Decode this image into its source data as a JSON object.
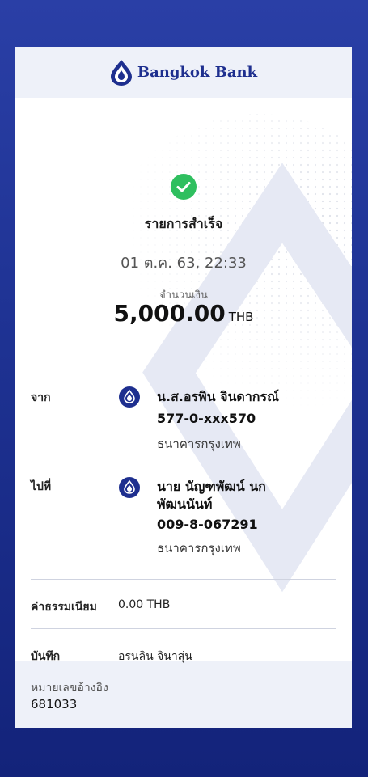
{
  "header": {
    "bank_name": "Bangkok Bank",
    "logo_icon": "lotus-logo-icon"
  },
  "status": {
    "icon": "check-circle-icon",
    "text": "รายการสำเร็จ",
    "color": "#2fbf5f"
  },
  "datetime": "01 ต.ค. 63, 22:33",
  "amount": {
    "label": "จำนวนเงิน",
    "value": "5,000.00",
    "currency": "THB"
  },
  "from": {
    "label": "จาก",
    "icon": "bangkok-bank-icon",
    "name": "น.ส.อรพิน  จินดากรณ์",
    "account": "577-0-xxx570",
    "bank": "ธนาคารกรุงเทพ"
  },
  "to": {
    "label": "ไปที่",
    "icon": "bangkok-bank-icon",
    "name": "นาย นัญฑพัฒน์ นก พัฒนนันท์",
    "account": "009-8-067291",
    "bank": "ธนาคารกรุงเทพ"
  },
  "fee": {
    "label": "ค่าธรรมเนียม",
    "value": "0.00 THB"
  },
  "note": {
    "label": "บันทึก",
    "value": "อรนลิน จินาสุ่น"
  },
  "reference": {
    "label": "หมายเลขอ้างอิง",
    "value": "681033"
  },
  "colors": {
    "brand": "#1e2f8f",
    "success": "#2fbf5f"
  }
}
